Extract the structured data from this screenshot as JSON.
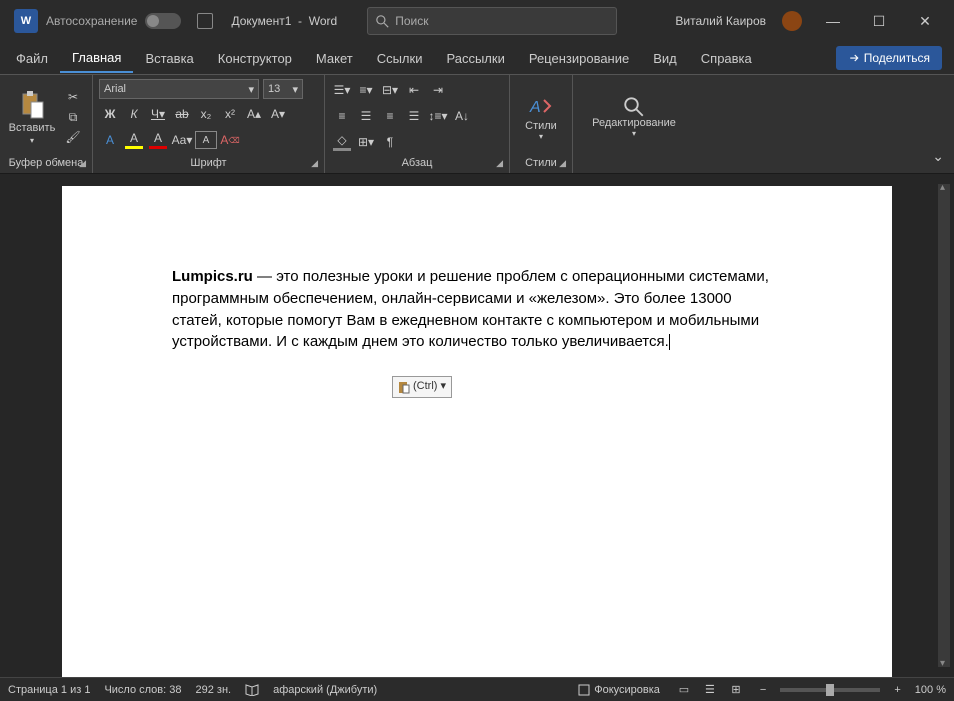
{
  "title": {
    "autosave": "Автосохранение",
    "document": "Документ1",
    "appname": "Word",
    "search_placeholder": "Поиск",
    "username": "Виталий Каиров"
  },
  "menu": {
    "file": "Файл",
    "home": "Главная",
    "insert": "Вставка",
    "design": "Конструктор",
    "layout": "Макет",
    "links": "Ссылки",
    "mailings": "Рассылки",
    "review": "Рецензирование",
    "view": "Вид",
    "help": "Справка",
    "share": "Поделиться"
  },
  "ribbon": {
    "clipboard": {
      "paste": "Вставить",
      "label": "Буфер обмена"
    },
    "font": {
      "name": "Arial",
      "size": "13",
      "label": "Шрифт",
      "bold": "Ж",
      "italic": "К",
      "underline": "Ч",
      "strike": "ab",
      "sub": "x₂",
      "sup": "x²",
      "effects": "A",
      "highlight": "A",
      "color": "A",
      "case": "Aa",
      "clear": "A"
    },
    "paragraph": {
      "label": "Абзац"
    },
    "styles": {
      "title": "Стили",
      "label": "Стили"
    },
    "editing": {
      "title": "Редактирование"
    }
  },
  "document": {
    "bold": "Lumpics.ru",
    "text": " — это полезные уроки и решение проблем с операционными системами, программным обеспечением, онлайн-сервисами и «железом». Это более 13000 статей, которые помогут Вам в ежедневном контакте с компьютером и мобильными устройствами. И с каждым днем это количество только увеличивается.",
    "paste_tag": "(Ctrl)"
  },
  "status": {
    "page": "Страница 1 из 1",
    "words": "Число слов: 38",
    "chars": "292 зн.",
    "lang": "афарский (Джибути)",
    "focus": "Фокусировка",
    "zoom": "100 %"
  }
}
